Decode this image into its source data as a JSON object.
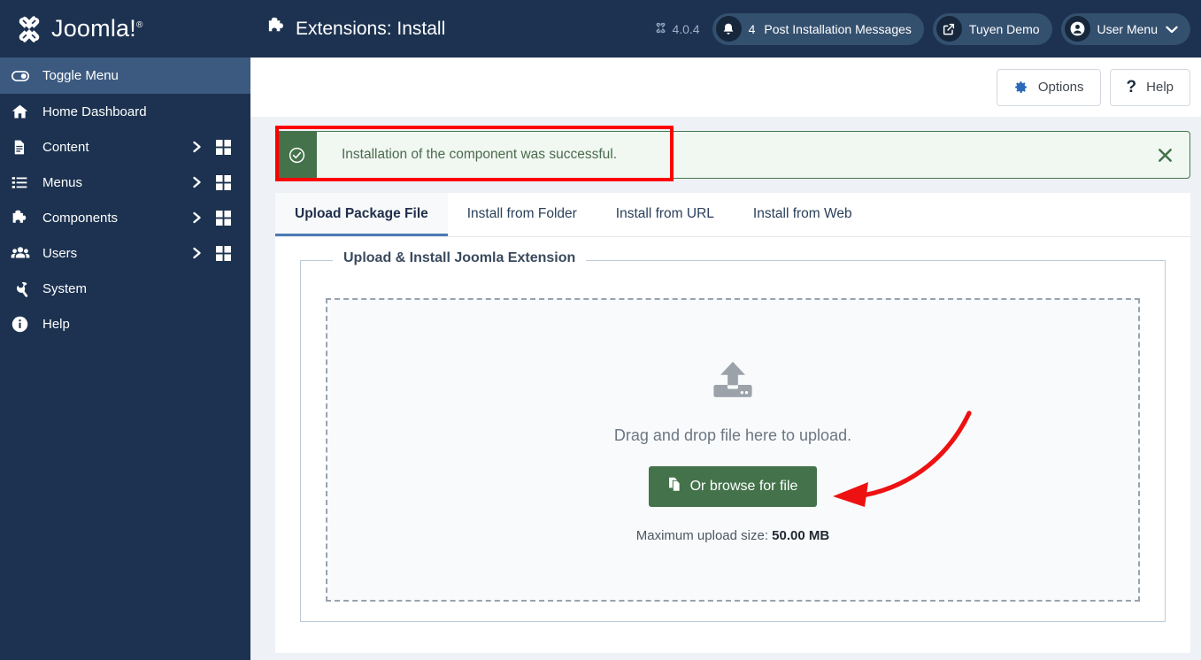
{
  "brand": {
    "name": "Joomla!",
    "registered": "®",
    "logo_icon": "joomla-logo-icon"
  },
  "sidebar": {
    "items": [
      {
        "label": "Toggle Menu",
        "icon": "toggle-icon",
        "active": true,
        "has_chevron": false,
        "has_grid": false
      },
      {
        "label": "Home Dashboard",
        "icon": "home-icon",
        "active": false,
        "has_chevron": false,
        "has_grid": false
      },
      {
        "label": "Content",
        "icon": "document-icon",
        "active": false,
        "has_chevron": true,
        "has_grid": true
      },
      {
        "label": "Menus",
        "icon": "list-icon",
        "active": false,
        "has_chevron": true,
        "has_grid": true
      },
      {
        "label": "Components",
        "icon": "puzzle-icon",
        "active": false,
        "has_chevron": true,
        "has_grid": true
      },
      {
        "label": "Users",
        "icon": "users-icon",
        "active": false,
        "has_chevron": true,
        "has_grid": true
      },
      {
        "label": "System",
        "icon": "wrench-icon",
        "active": false,
        "has_chevron": false,
        "has_grid": false
      },
      {
        "label": "Help",
        "icon": "info-icon",
        "active": false,
        "has_chevron": false,
        "has_grid": false
      }
    ]
  },
  "header": {
    "title": "Extensions: Install",
    "title_icon": "puzzle-icon",
    "version": "4.0.4",
    "version_icon": "joomla-mark-icon",
    "messages": {
      "label": "Post Installation Messages",
      "count": "4",
      "icon": "bell-icon"
    },
    "site": {
      "label": "Tuyen Demo",
      "icon": "external-link-icon"
    },
    "user_menu": {
      "label": "User Menu",
      "icon": "user-circle-icon",
      "caret": "chevron-down-icon"
    }
  },
  "toolbar": {
    "options_label": "Options",
    "options_icon": "gear-icon",
    "help_label": "Help",
    "help_icon": "question-mark-icon"
  },
  "alert": {
    "message": "Installation of the component was successful.",
    "icon": "check-circle-icon",
    "close_icon": "close-icon",
    "type": "success",
    "border_color": "#46774d",
    "icon_bg": "#44734b",
    "background": "#f1f7f1"
  },
  "annotation": {
    "highlight_color": "#fd0000",
    "arrow_color": "#ee1111",
    "arrow_name": "red-curved-arrow"
  },
  "tabs": [
    {
      "label": "Upload Package File",
      "active": true
    },
    {
      "label": "Install from Folder",
      "active": false
    },
    {
      "label": "Install from URL",
      "active": false
    },
    {
      "label": "Install from Web",
      "active": false
    }
  ],
  "upload_panel": {
    "legend": "Upload & Install Joomla Extension",
    "upload_icon": "upload-icon",
    "drop_text": "Drag and drop file here to upload.",
    "browse_button": {
      "label": "Or browse for file",
      "icon": "files-icon",
      "color": "#44734b"
    },
    "max_size_label": "Maximum upload size:",
    "max_size_value": "50.00 MB"
  }
}
